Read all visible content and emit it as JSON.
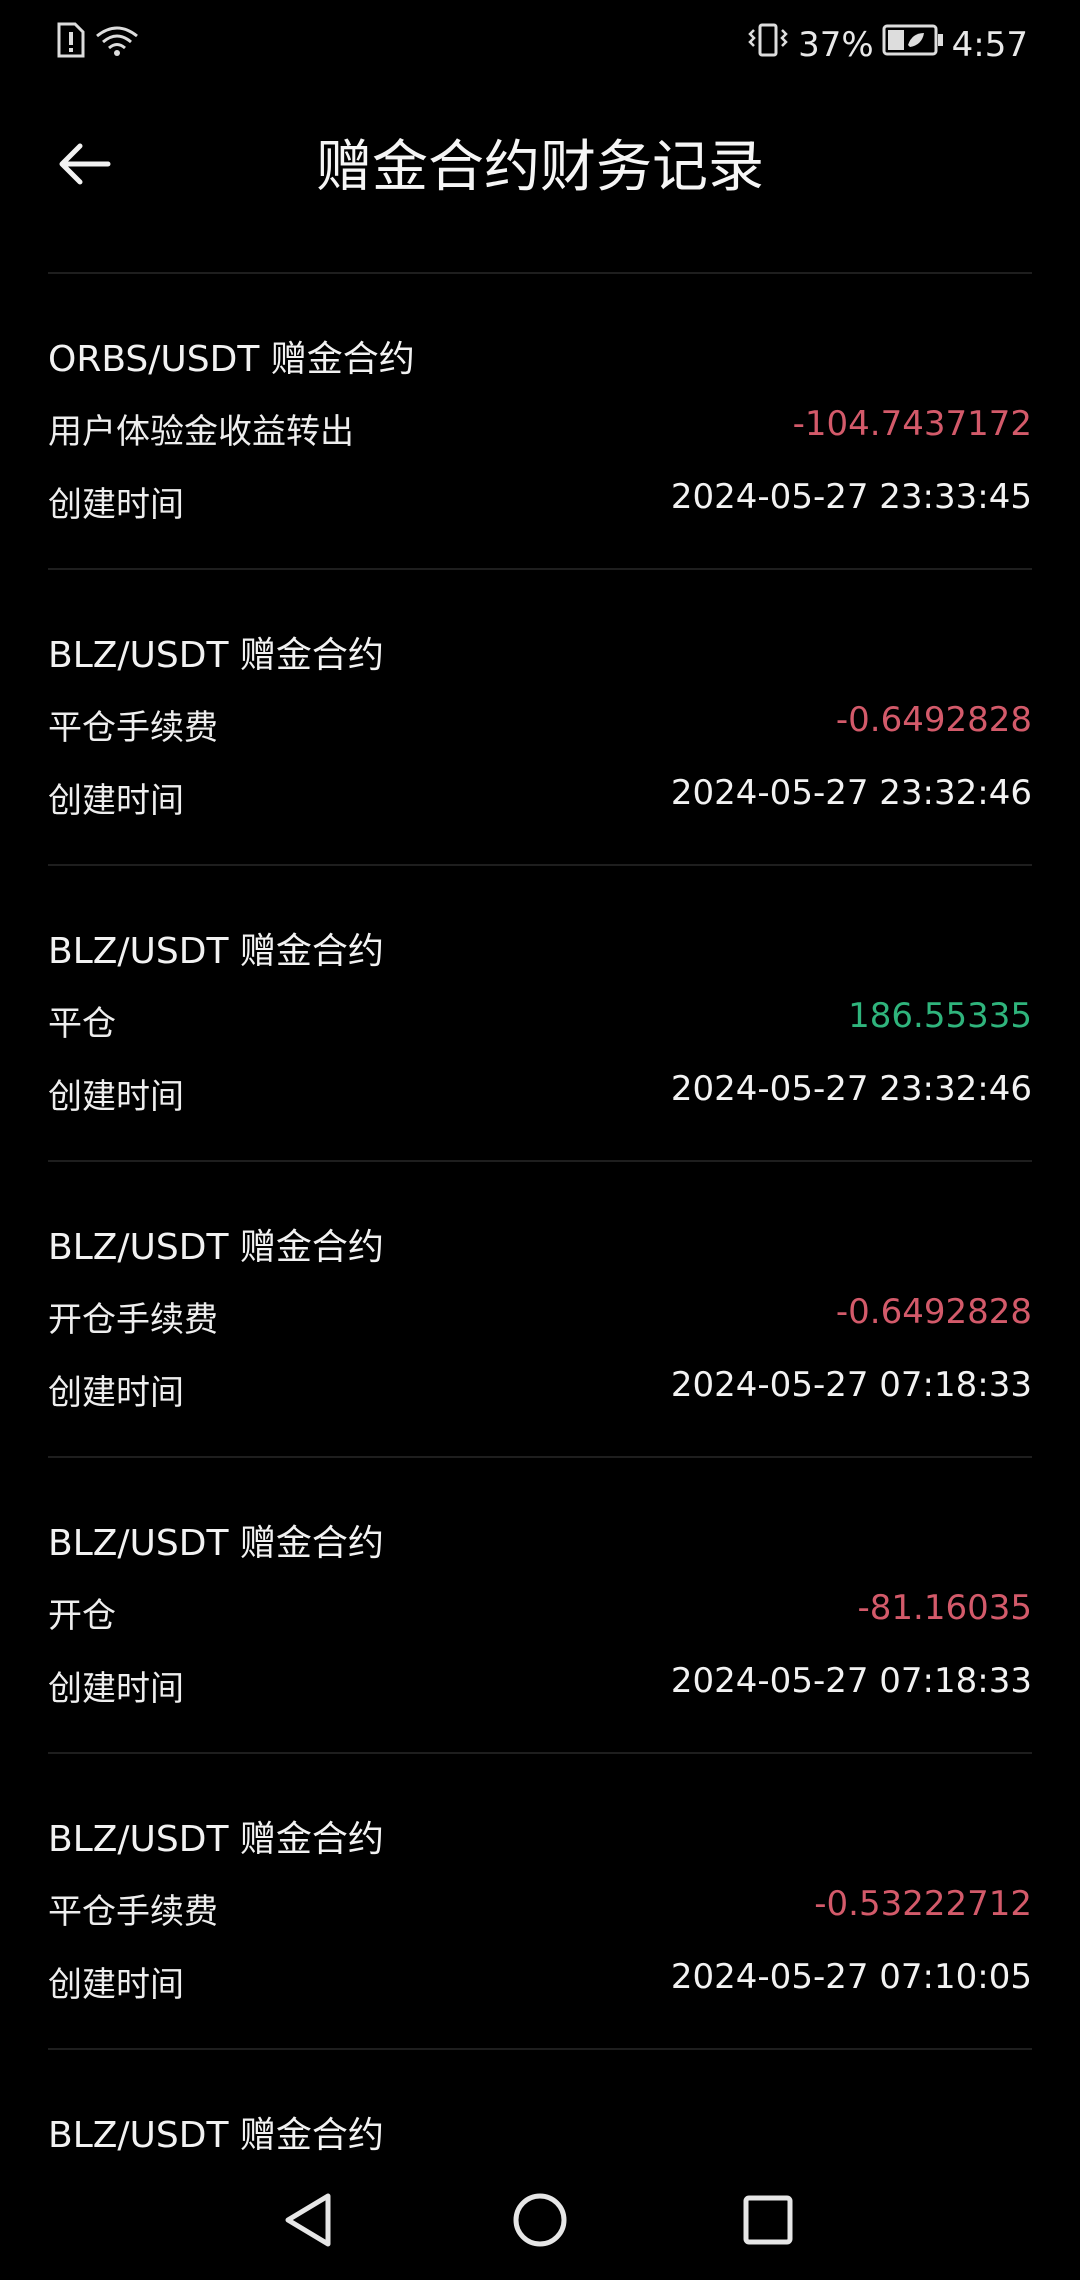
{
  "status_bar": {
    "battery_percent": "37%",
    "time": "4:57"
  },
  "header": {
    "title": "赠金合约财务记录"
  },
  "records": [
    {
      "title": "ORBS/USDT 赠金合约",
      "type": "用户体验金收益转出",
      "amount": "-104.7437172",
      "time_label": "创建时间",
      "time": "2024-05-27 23:33:45"
    },
    {
      "title": "BLZ/USDT 赠金合约",
      "type": "平仓手续费",
      "amount": "-0.6492828",
      "time_label": "创建时间",
      "time": "2024-05-27 23:32:46"
    },
    {
      "title": "BLZ/USDT 赠金合约",
      "type": "平仓",
      "amount": "186.55335",
      "time_label": "创建时间",
      "time": "2024-05-27 23:32:46"
    },
    {
      "title": "BLZ/USDT 赠金合约",
      "type": "开仓手续费",
      "amount": "-0.6492828",
      "time_label": "创建时间",
      "time": "2024-05-27 07:18:33"
    },
    {
      "title": "BLZ/USDT 赠金合约",
      "type": "开仓",
      "amount": "-81.16035",
      "time_label": "创建时间",
      "time": "2024-05-27 07:18:33"
    },
    {
      "title": "BLZ/USDT 赠金合约",
      "type": "平仓手续费",
      "amount": "-0.53222712",
      "time_label": "创建时间",
      "time": "2024-05-27 07:10:05"
    }
  ],
  "partial_record": {
    "title": "BLZ/USDT 赠金合约"
  },
  "colors": {
    "negative": "#d35a6a",
    "positive": "#2fb47c",
    "background": "#000000"
  }
}
